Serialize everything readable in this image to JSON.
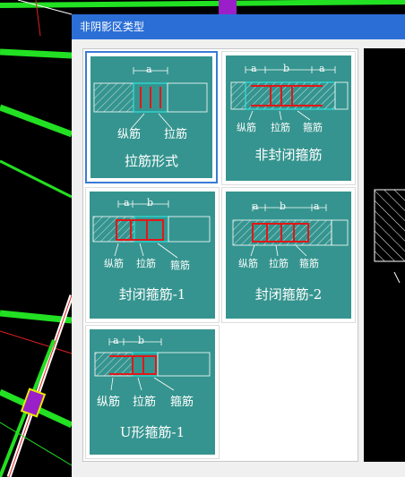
{
  "dialog": {
    "title": "非阴影区类型"
  },
  "options": [
    {
      "label": "拉筋形式",
      "dims": [
        "a"
      ],
      "parts": [
        "纵筋",
        "拉筋"
      ],
      "selected": true
    },
    {
      "label": "非封闭箍筋",
      "dims": [
        "a",
        "b",
        "a"
      ],
      "parts": [
        "纵筋",
        "拉筋",
        "箍筋"
      ],
      "selected": false
    },
    {
      "label": "封闭箍筋-1",
      "dims": [
        "a",
        "b"
      ],
      "parts": [
        "纵筋",
        "拉筋",
        "箍筋"
      ],
      "selected": false
    },
    {
      "label": "封闭箍筋-2",
      "dims": [
        "a",
        "b",
        "a"
      ],
      "parts": [
        "纵筋",
        "拉筋",
        "箍筋"
      ],
      "selected": false
    },
    {
      "label": "U形箍筋-1",
      "dims": [
        "a",
        "b"
      ],
      "parts": [
        "纵筋",
        "拉筋",
        "箍筋"
      ],
      "selected": false
    }
  ],
  "colors": {
    "titlebar": "#2b6fd6",
    "card": "#35948f",
    "rebar": "#e01818",
    "selection": "#3a7bd5"
  }
}
